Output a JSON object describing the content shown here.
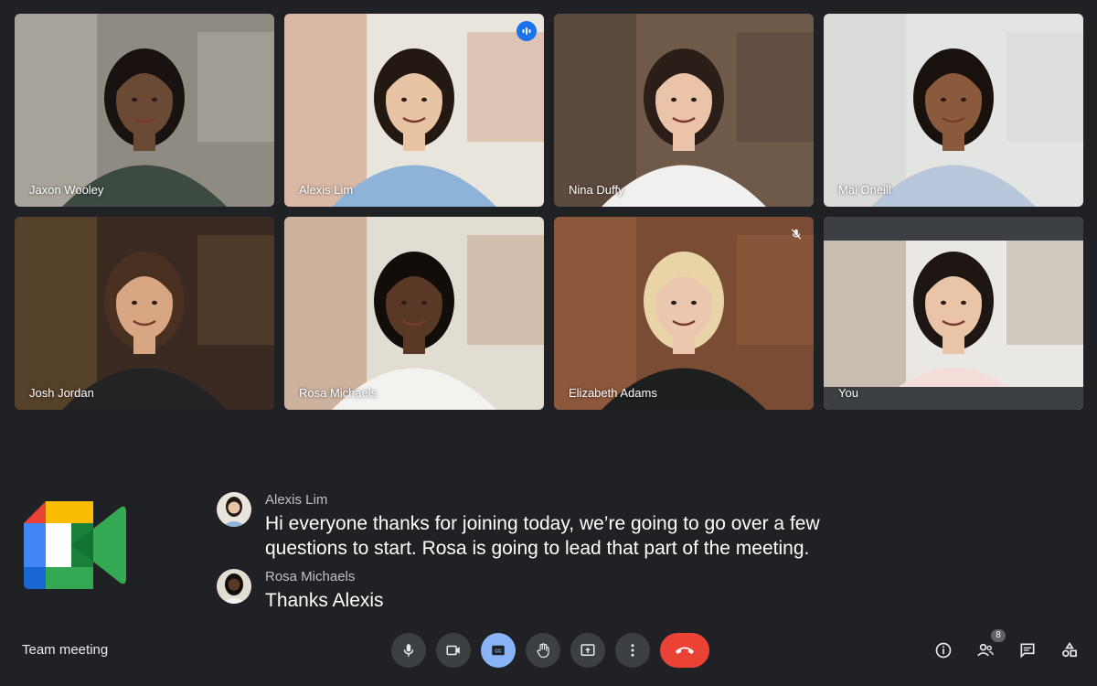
{
  "participants": [
    {
      "name": "Jaxon Wooley",
      "skin": "#6b4a35",
      "hair": "#1a1210",
      "shirt": "#3c4a42",
      "bg": "#8f8a82",
      "accent": "#d8d4cc"
    },
    {
      "name": "Alexis Lim",
      "skin": "#e8c3a4",
      "hair": "#231812",
      "shirt": "#8eb3d8",
      "bg": "#e9e5dd",
      "accent": "#c0643c",
      "speaking": true
    },
    {
      "name": "Nina Duffy",
      "skin": "#eac3a8",
      "hair": "#2b1d17",
      "shirt": "#f2f0ee",
      "bg": "#6f5a4a",
      "accent": "#3d2f27"
    },
    {
      "name": "Mai Oneill",
      "skin": "#8a5a3c",
      "hair": "#18110d",
      "shirt": "#b9c7dc",
      "bg": "#e3e5e2",
      "accent": "#c9ccc8"
    },
    {
      "name": "Josh Jordan",
      "skin": "#d9a684",
      "hair": "#4a3020",
      "shirt": "#232326",
      "bg": "#3a2a22",
      "accent": "#8a6b3a"
    },
    {
      "name": "Rosa Michaels",
      "skin": "#5a3826",
      "hair": "#130d0a",
      "shirt": "#f3f2ef",
      "bg": "#e2ddd2",
      "accent": "#a5633f"
    },
    {
      "name": "Elizabeth Adams",
      "skin": "#ecc7b0",
      "hair": "#e9d4a8",
      "shirt": "#1d1f1e",
      "bg": "#7a4c34",
      "accent": "#b16e4a",
      "muted": true
    },
    {
      "name": "You",
      "skin": "#e9c4a6",
      "hair": "#1e1612",
      "shirt": "#f4dcd8",
      "bg": "#eae8e5",
      "accent": "#8d6b4d",
      "self": true
    }
  ],
  "captions": [
    {
      "speaker": "Alexis Lim",
      "text": "Hi everyone thanks for joining today, we’re going to go over a few questions to start. Rosa is going to lead that part of the meeting."
    },
    {
      "speaker": "Rosa Michaels",
      "text": "Thanks Alexis"
    }
  ],
  "meeting": {
    "title": "Team meeting",
    "participant_count": "8"
  },
  "controls": [
    {
      "name": "microphone-button",
      "icon": "mic-icon"
    },
    {
      "name": "camera-button",
      "icon": "videocam-icon"
    },
    {
      "name": "captions-button",
      "icon": "closed-caption-icon",
      "active": true
    },
    {
      "name": "raise-hand-button",
      "icon": "hand-icon"
    },
    {
      "name": "present-button",
      "icon": "present-screen-icon"
    },
    {
      "name": "more-options-button",
      "icon": "more-vert-icon"
    },
    {
      "name": "leave-call-button",
      "icon": "call-end-icon",
      "end": true
    }
  ],
  "right_actions": [
    "meeting-details-icon",
    "people-icon",
    "chat-icon",
    "activities-icon"
  ],
  "colors": {
    "background": "#202124",
    "tile": "#3c4043",
    "accent_blue": "#8ab4f8",
    "end_call": "#ea4335",
    "speaking": "#1a73e8"
  }
}
